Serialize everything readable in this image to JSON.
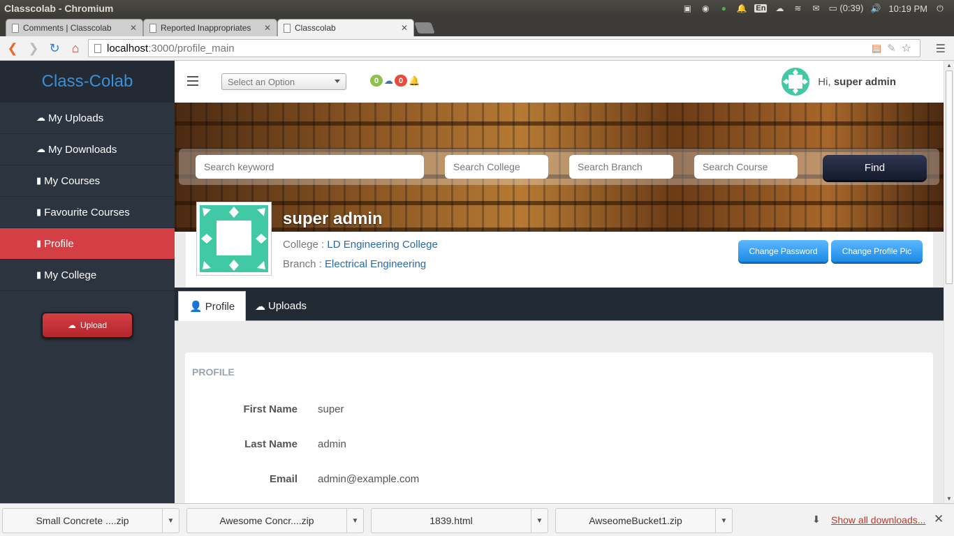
{
  "os": {
    "window_title": "Classcolab - Chromium",
    "battery": "(0:39)",
    "time": "10:19 PM",
    "lang": "En"
  },
  "browser": {
    "tabs": [
      {
        "label": "Comments | Classcolab"
      },
      {
        "label": "Reported Inappropriates"
      },
      {
        "label": "Classcolab"
      }
    ],
    "url_host": "localhost",
    "url_path": ":3000/profile_main"
  },
  "sidebar": {
    "brand": "Class-Colab",
    "items": [
      {
        "label": "My Uploads",
        "icon": "cloud-upload-icon"
      },
      {
        "label": "My Downloads",
        "icon": "cloud-download-icon"
      },
      {
        "label": "My Courses",
        "icon": "book-icon"
      },
      {
        "label": "Favourite Courses",
        "icon": "book-icon"
      },
      {
        "label": "Profile",
        "icon": "book-icon",
        "active": true
      },
      {
        "label": "My College",
        "icon": "book-icon"
      }
    ],
    "upload_label": "Upload"
  },
  "topnav": {
    "select_placeholder": "Select an Option",
    "badge_uploads": "0",
    "badge_notifications": "0",
    "greeting": "Hi,",
    "username": "super admin"
  },
  "search": {
    "keyword_placeholder": "Search keyword",
    "college_placeholder": "Search College",
    "branch_placeholder": "Search Branch",
    "course_placeholder": "Search Course",
    "find_label": "Find"
  },
  "profile_header": {
    "name": "super admin",
    "college_label": "College :",
    "college": "LD Engineering College",
    "branch_label": "Branch :",
    "branch": "Electrical Engineering",
    "change_password": "Change Password",
    "change_pic": "Change Profile Pic"
  },
  "profile_tabs": [
    {
      "label": "Profile",
      "active": true
    },
    {
      "label": "Uploads"
    }
  ],
  "profile_panel": {
    "title": "PROFILE",
    "fields": [
      {
        "label": "First Name",
        "value": "super"
      },
      {
        "label": "Last Name",
        "value": "admin"
      },
      {
        "label": "Email",
        "value": "admin@example.com"
      }
    ]
  },
  "downloads": {
    "items": [
      {
        "name": "Small Concrete ....zip"
      },
      {
        "name": "Awesome Concr....zip"
      },
      {
        "name": "1839.html"
      },
      {
        "name": "AwseomeBucket1.zip"
      }
    ],
    "show_all": "Show all downloads..."
  },
  "colors": {
    "sidebar_bg": "#2c3440",
    "brand_blue": "#3b8fd6",
    "active_red": "#d43f45",
    "teal": "#41c9a5",
    "link_blue": "#2a6aa8"
  }
}
